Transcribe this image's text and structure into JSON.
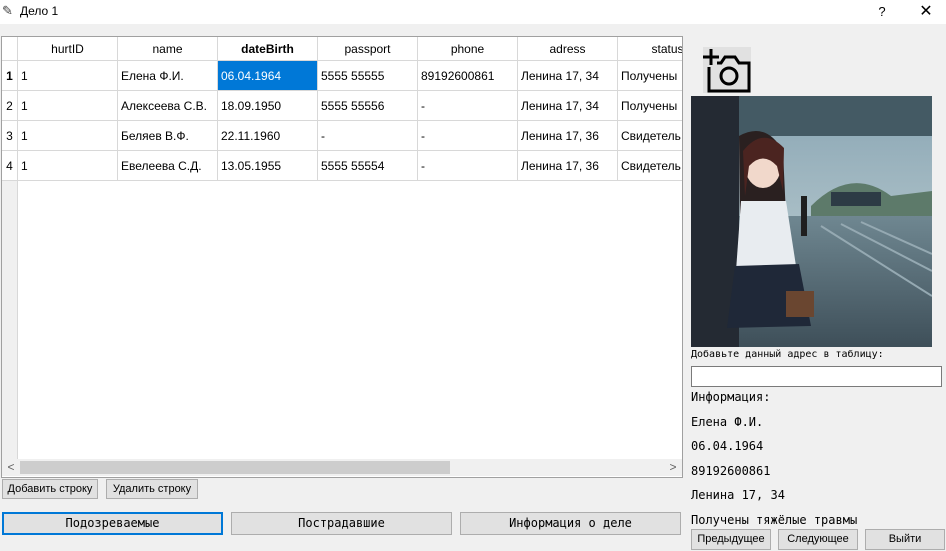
{
  "window": {
    "title": "Дело 1",
    "help": "?",
    "close": "✕"
  },
  "table": {
    "columns": [
      "hurtID",
      "name",
      "dateBirth",
      "passport",
      "phone",
      "adress",
      "status"
    ],
    "row_numbers": [
      "1",
      "2",
      "3",
      "4"
    ],
    "rows": [
      [
        "1",
        "Елена Ф.И.",
        "06.04.1964",
        "5555 55555",
        "89192600861",
        "Ленина 17, 34",
        "Получены"
      ],
      [
        "1",
        "Алексеева С.В.",
        "18.09.1950",
        "5555 55556",
        "-",
        "Ленина 17, 34",
        "Получены"
      ],
      [
        "1",
        "Беляев В.Ф.",
        "22.11.1960",
        "-",
        "-",
        "Ленина 17, 36",
        "Свидетель"
      ],
      [
        "1",
        "Евелеева С.Д.",
        "13.05.1955",
        "5555 55554",
        "-",
        "Ленина 17, 36",
        "Свидетель"
      ]
    ],
    "scroll_left": "<",
    "scroll_right": ">"
  },
  "buttons": {
    "add_row": "Добавить строку",
    "delete_row": "Удалить строку",
    "suspects": "Подозреваемые",
    "victims": "Пострадавшие",
    "case_info": "Информация о деле",
    "prev": "Предыдущее",
    "next": "Следующее",
    "exit": "Выйти"
  },
  "side": {
    "address_prompt": "Добавьте данный адрес в таблицу:",
    "address_value": "",
    "info_heading": "Информация:",
    "info_name": "Елена Ф.И.",
    "info_date": "06.04.1964",
    "info_phone": "89192600861",
    "info_address": "Ленина 17, 34",
    "info_status": "Получены тяжёлые травмы"
  },
  "icons": {
    "camera": "camera-add-icon",
    "app": "app-icon"
  },
  "colors": {
    "selection": "#0078d7",
    "focus_border": "#0078d7"
  }
}
